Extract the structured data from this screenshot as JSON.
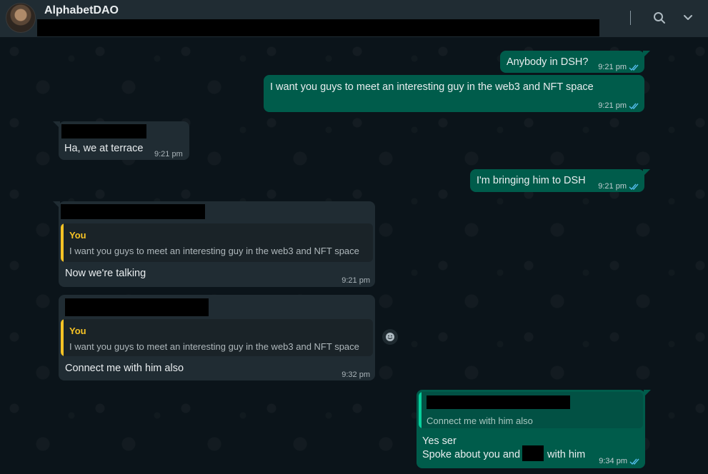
{
  "header": {
    "title": "AlphabetDAO"
  },
  "messages": {
    "m1": {
      "text": "Anybody in DSH?",
      "time": "9:21 pm"
    },
    "m2": {
      "text": "I want you guys to meet an interesting guy in the web3 and NFT space",
      "time": "9:21 pm"
    },
    "m3": {
      "text": "Ha, we at terrace",
      "time": "9:21 pm"
    },
    "m4": {
      "text": "I'm bringing him to DSH",
      "time": "9:21 pm"
    },
    "m5": {
      "quote_author": "You",
      "quote_text": "I want you guys to meet an interesting guy in the web3 and NFT space",
      "text": "Now we're talking",
      "time": "9:21 pm"
    },
    "m6": {
      "quote_author": "You",
      "quote_text": "I want you guys to meet an interesting guy in the web3 and NFT space",
      "text": "Connect me with him also",
      "time": "9:32 pm"
    },
    "m7": {
      "quote_text": "Connect me with him also",
      "line1": "Yes ser",
      "line2_a": "Spoke about you and",
      "line2_b": "with him",
      "time": "9:34 pm"
    }
  },
  "colors": {
    "outgoing": "#005c4b",
    "incoming": "#202c33",
    "header": "#202c33",
    "background": "#0b141a",
    "quote_accent": "#f7c325",
    "read_ticks": "#53bdeb"
  },
  "icons": [
    "search-icon",
    "chevron-down-icon",
    "double-check-icon",
    "emoji-icon"
  ]
}
